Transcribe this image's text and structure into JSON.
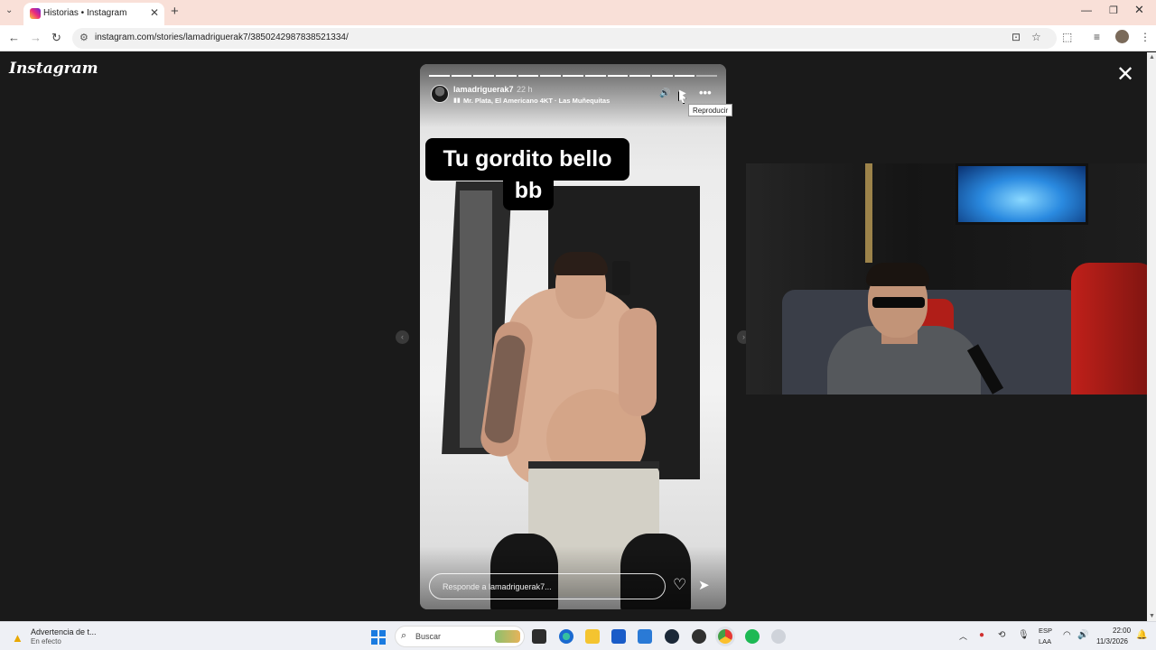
{
  "browser": {
    "tab_title": "Historias • Instagram",
    "tab_close": "✕",
    "tab_menu": "⌄",
    "new_tab": "+",
    "url": "instagram.com/stories/lamadriguerak7/3850242987838521334/",
    "window_minimize": "—",
    "window_maximize": "❐",
    "window_close": "✕",
    "nav_back": "←",
    "nav_forward": "→",
    "nav_reload": "↻",
    "icons": [
      "install-icon",
      "bookmark-star-icon",
      "extensions-icon",
      "media-controls-icon",
      "profile-icon",
      "menu-icon"
    ]
  },
  "page": {
    "logo": "Instagram",
    "close_story": "✕"
  },
  "story": {
    "progress": {
      "segments": 13,
      "completed": 12
    },
    "username": "lamadriguerak7",
    "time_ago": "22 h",
    "music": "Mr. Plata, El Americano 4KT · Las Muñequitas",
    "caption_line1": "Tu gordito bello",
    "caption_line2": "bb",
    "reply_placeholder": "Responde a lamadriguerak7...",
    "tooltip": "Reproducir",
    "sound_icon": "🔊",
    "play_icon": "▶",
    "more_icon": "•••",
    "like_icon": "♡",
    "share_icon": "➤"
  },
  "taskbar": {
    "notification_title": "Advertencia de t...",
    "notification_subtitle": "En efecto",
    "search_placeholder": "Buscar",
    "lang_line1": "ESP",
    "lang_line2": "LAA",
    "time": "22:00",
    "date": "11/3/2026",
    "apps": [
      "task-view",
      "edge",
      "file-explorer",
      "microsoft-store",
      "outlook",
      "steam",
      "obs",
      "chrome",
      "spotify",
      "unknown-app"
    ]
  },
  "colors": {
    "browser_tab_bar": "#f9e0d8",
    "page_background": "#1a1a1a",
    "windows_accent": "#1a7be0"
  }
}
